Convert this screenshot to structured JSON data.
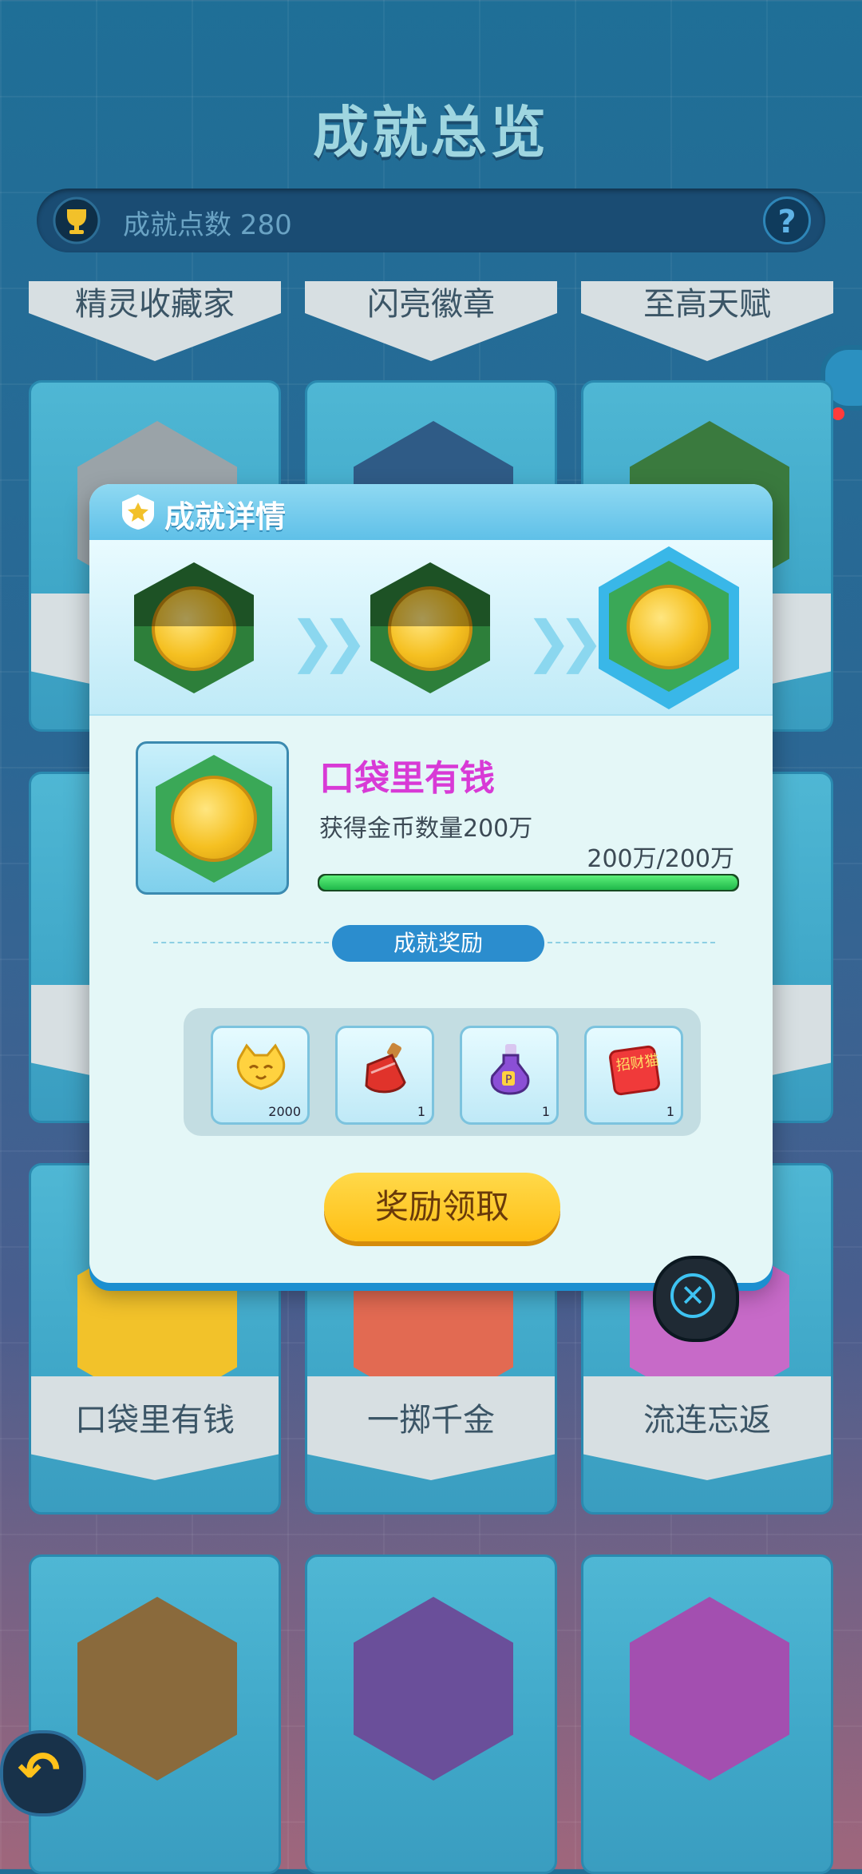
{
  "page": {
    "title": "成就总览"
  },
  "points": {
    "label": "成就点数 280",
    "help": "?"
  },
  "top_cards": [
    "精灵收藏家",
    "闪亮徽章",
    "至高天赋"
  ],
  "row_cards": [
    {
      "label": "口袋里有钱",
      "hex_color": "#f2c22a"
    },
    {
      "label": "一掷千金",
      "hex_color": "#e26a52"
    },
    {
      "label": "流连忘返",
      "hex_color": "#c76ac8"
    }
  ],
  "modal": {
    "title": "成就详情",
    "achievement_name": "口袋里有钱",
    "description": "获得金币数量200万",
    "progress_text": "200万/200万",
    "progress_fraction": 1.0,
    "reward_section_label": "成就奖励",
    "rewards": [
      {
        "icon": "cat-coin-icon",
        "count": "2000"
      },
      {
        "icon": "red-potion-icon",
        "count": "1"
      },
      {
        "icon": "purple-potion-icon",
        "count": "1"
      },
      {
        "icon": "lucky-cat-card-icon",
        "count": "1",
        "text": "招财猫"
      }
    ],
    "claim_label": "奖励领取",
    "close_glyph": "✕"
  },
  "colors": {
    "accent": "#2b8dce",
    "name": "#d83ad6",
    "claim": "#ffc21a"
  }
}
